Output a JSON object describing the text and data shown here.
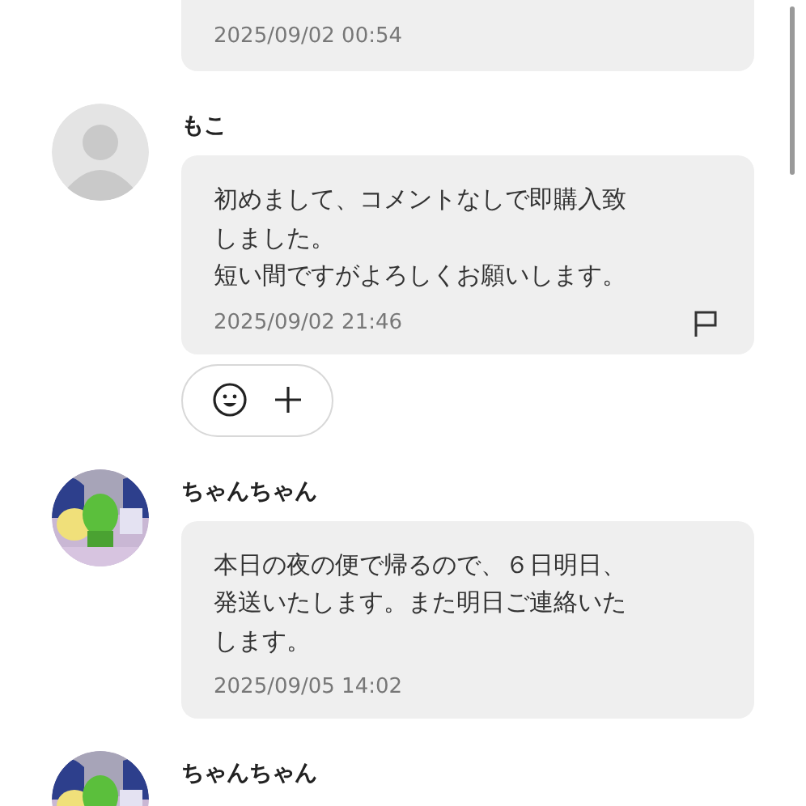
{
  "messages": [
    {
      "kind": "cut",
      "timestamp": "2025/09/02 00:54"
    },
    {
      "kind": "full",
      "name": "もこ",
      "avatar": {
        "kind": "default"
      },
      "paragraphs": [
        "初めまして、コメントなしで即購入致しました。",
        "短い間ですがよろしくお願いします。"
      ],
      "timestamp": "2025/09/02 21:46",
      "flag": true,
      "reactions": true
    },
    {
      "kind": "full",
      "name": "ちゃんちゃん",
      "avatar": {
        "kind": "picture"
      },
      "paragraphs": [
        "本日の夜の便で帰るので、６日明日、発送いたします。また明日ご連絡いたします。"
      ],
      "timestamp": "2025/09/05 14:02",
      "flag": false,
      "reactions": false
    },
    {
      "kind": "header",
      "name": "ちゃんちゃん",
      "avatar": {
        "kind": "picture"
      }
    }
  ]
}
